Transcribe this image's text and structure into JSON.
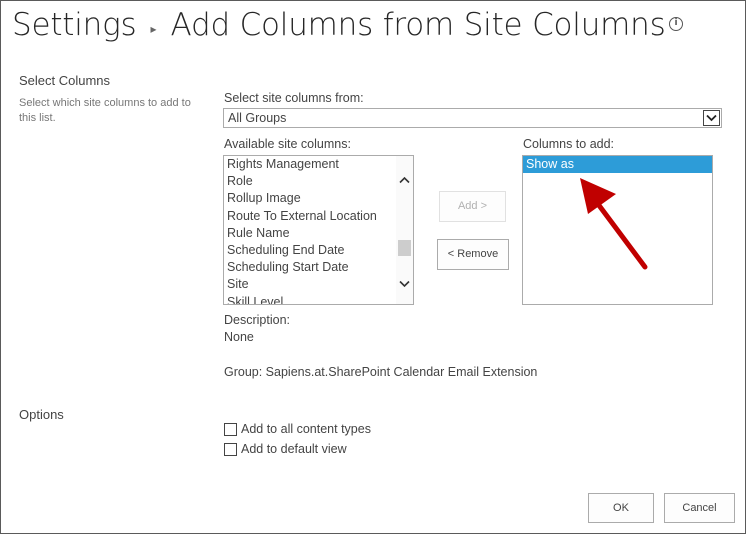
{
  "header": {
    "breadcrumb_root": "Settings",
    "separator_glyph": "▸",
    "page_title": "Add Columns from Site Columns",
    "info_icon_glyph": "i"
  },
  "select_columns": {
    "section_title": "Select Columns",
    "section_description": "Select which site columns to add to this list.",
    "source_label": "Select site columns from:",
    "source_value": "All Groups",
    "available_label": "Columns to add:",
    "available_heading": "Available site columns:",
    "available_items": [
      "Rights Management",
      "Role",
      "Rollup Image",
      "Route To External Location",
      "Rule Name",
      "Scheduling End Date",
      "Scheduling Start Date",
      "Site",
      "Skill Level"
    ],
    "columns_to_add": [
      "Show as"
    ],
    "add_button": "Add >",
    "remove_button": "< Remove",
    "description_label": "Description:",
    "description_value": "None",
    "group_text": "Group: Sapiens.at.SharePoint Calendar Email Extension"
  },
  "options": {
    "section_title": "Options",
    "add_to_content_types": "Add to all content types",
    "add_to_default_view": "Add to default view",
    "add_to_content_types_checked": false,
    "add_to_default_view_checked": false
  },
  "footer": {
    "ok_button": "OK",
    "cancel_button": "Cancel"
  },
  "colors": {
    "selection": "#2d9cd8",
    "annotation_arrow": "#c00000",
    "title_text": "#262626"
  }
}
